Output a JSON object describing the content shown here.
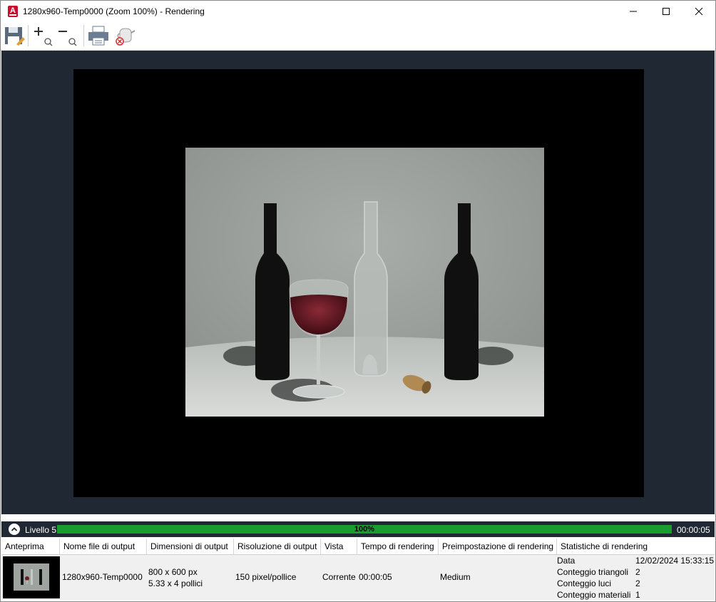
{
  "window": {
    "title": "1280x960-Temp0000 (Zoom 100%) - Rendering",
    "app_icon_letter": "A"
  },
  "toolbar": {
    "buttons": [
      {
        "name": "save",
        "icon": "save-icon"
      },
      {
        "name": "zoom-in",
        "icon": "zoom-in-icon"
      },
      {
        "name": "zoom-out",
        "icon": "zoom-out-icon"
      },
      {
        "name": "print",
        "icon": "printer-icon"
      },
      {
        "name": "cancel-render",
        "icon": "teapot-cancel-icon"
      }
    ]
  },
  "status": {
    "level_label": "Livello 5",
    "progress_percent": 100,
    "progress_text": "100%",
    "elapsed": "00:00:05",
    "progress_color": "#1a9c2f"
  },
  "table": {
    "headers": [
      "Anteprima",
      "Nome file di output",
      "Dimensioni di output",
      "Risoluzione di output",
      "Vista",
      "Tempo di rendering",
      "Preimpostazione di rendering",
      "Statistiche di rendering"
    ],
    "row": {
      "file_name": "1280x960-Temp0000",
      "size_px": "800 x 600 px",
      "size_in": "5.33 x 4 pollici",
      "resolution": "150 pixel/pollice",
      "view": "Corrente",
      "time": "00:00:05",
      "preset": "Medium",
      "stats": [
        {
          "label": "Data",
          "value": "12/02/2024 15:33:15"
        },
        {
          "label": "Conteggio triangoli",
          "value": "2"
        },
        {
          "label": "Conteggio luci",
          "value": "2"
        },
        {
          "label": "Conteggio materiali",
          "value": "1"
        }
      ]
    }
  }
}
